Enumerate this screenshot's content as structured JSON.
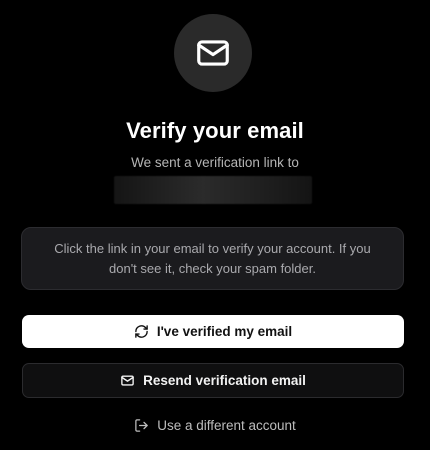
{
  "header": {
    "icon": "mail-icon",
    "title": "Verify your email",
    "subtitle": "We sent a verification link to"
  },
  "info": {
    "text": "Click the link in your email to verify your account. If you don't see it, check your spam folder."
  },
  "actions": {
    "verified_label": "I've verified my email",
    "verified_icon": "refresh-icon",
    "resend_label": "Resend verification email",
    "resend_icon": "mail-icon",
    "switch_label": "Use a different account",
    "switch_icon": "log-out-icon"
  },
  "colors": {
    "background": "#000000",
    "primary_button": "#ffffff",
    "info_box": "#1b1b1e"
  }
}
